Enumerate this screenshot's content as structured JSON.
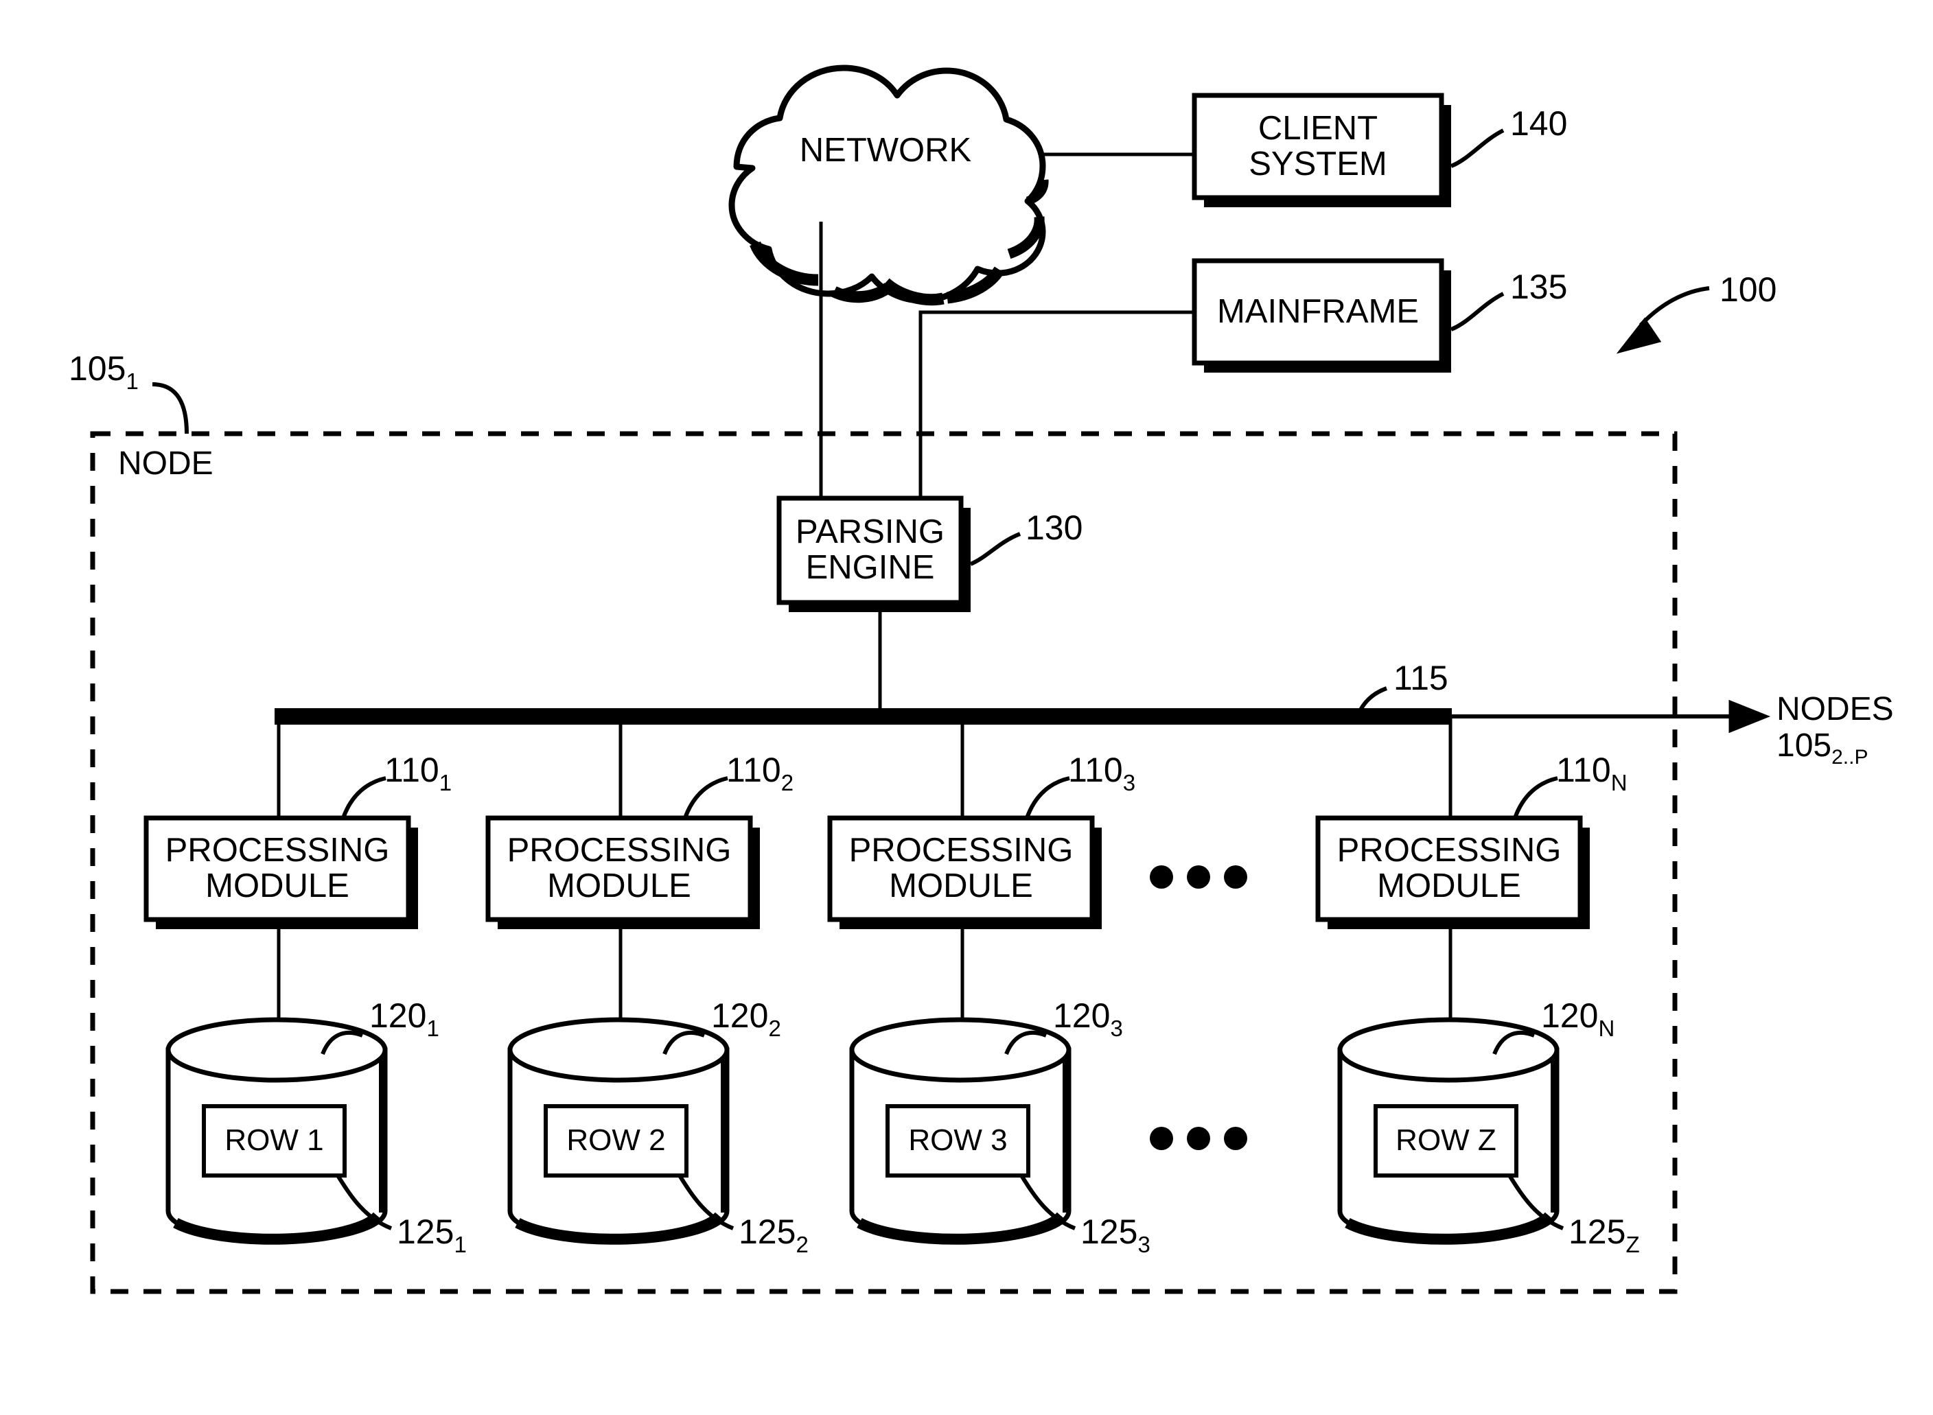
{
  "figure": {
    "figure_ref": "100",
    "node_container": {
      "label": "NODE",
      "ref_base": "105",
      "ref_sub": "1"
    },
    "external_nodes": {
      "line1": "NODES",
      "ref_base": "105",
      "ref_sub": "2..P"
    }
  },
  "blocks": {
    "network": {
      "label": "NETWORK",
      "icon": "cloud-icon"
    },
    "client_system": {
      "line1": "CLIENT",
      "line2": "SYSTEM",
      "ref": "140"
    },
    "mainframe": {
      "label": "MAINFRAME",
      "ref": "135"
    },
    "parsing_engine": {
      "line1": "PARSING",
      "line2": "ENGINE",
      "ref": "130"
    },
    "bus": {
      "ref": "115"
    }
  },
  "processing_modules": [
    {
      "line1": "PROCESSING",
      "line2": "MODULE",
      "ref_base": "110",
      "ref_sub": "1"
    },
    {
      "line1": "PROCESSING",
      "line2": "MODULE",
      "ref_base": "110",
      "ref_sub": "2"
    },
    {
      "line1": "PROCESSING",
      "line2": "MODULE",
      "ref_base": "110",
      "ref_sub": "3"
    },
    {
      "line1": "PROCESSING",
      "line2": "MODULE",
      "ref_base": "110",
      "ref_sub": "N"
    }
  ],
  "data_storage": [
    {
      "store_ref_base": "120",
      "store_ref_sub": "1",
      "row_label": "ROW 1",
      "row_ref_base": "125",
      "row_ref_sub": "1"
    },
    {
      "store_ref_base": "120",
      "store_ref_sub": "2",
      "row_label": "ROW 2",
      "row_ref_base": "125",
      "row_ref_sub": "2"
    },
    {
      "store_ref_base": "120",
      "store_ref_sub": "3",
      "row_label": "ROW 3",
      "row_ref_base": "125",
      "row_ref_sub": "3"
    },
    {
      "store_ref_base": "120",
      "store_ref_sub": "N",
      "row_label": "ROW Z",
      "row_ref_base": "125",
      "row_ref_sub": "Z"
    }
  ],
  "ellipses": {
    "glyph": "• • •"
  },
  "colors": {
    "stroke": "#000000",
    "fill": "#ffffff"
  }
}
